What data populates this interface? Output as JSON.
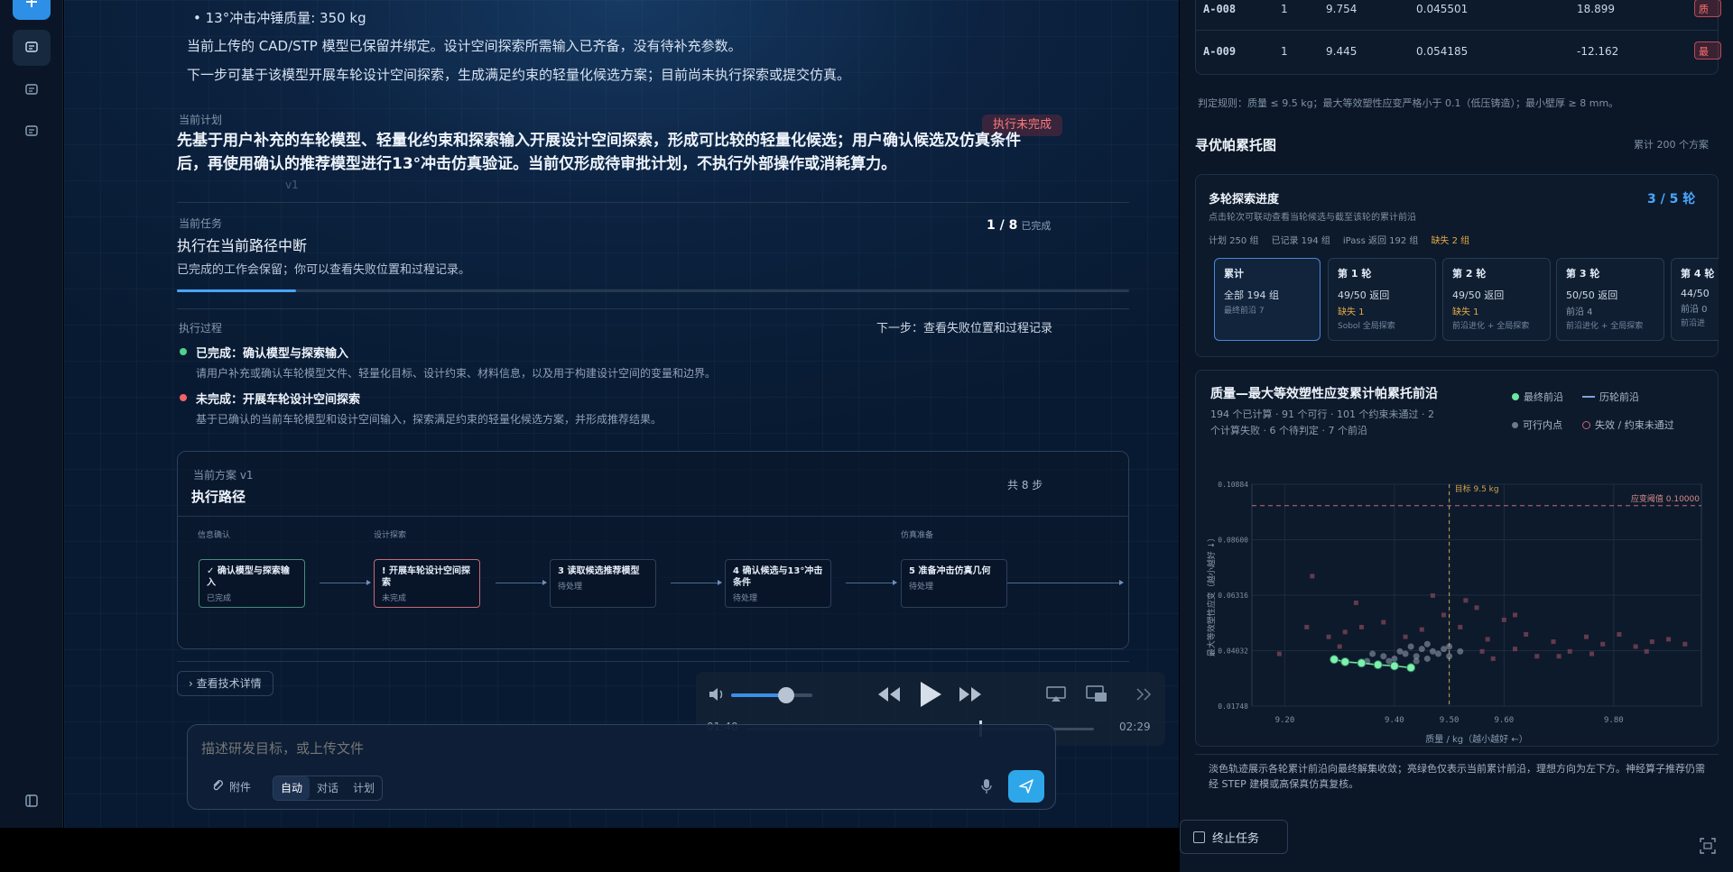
{
  "main": {
    "bullet": "13°冲击冲锤质量: 350 kg",
    "para1": "当前上传的 CAD/STP 模型已保留并绑定。设计空间探索所需输入已齐备，没有待补充参数。",
    "para2": "下一步可基于该模型开展车轮设计空间探索，生成满足约束的轻量化候选方案；目前尚未执行探索或提交仿真。",
    "plan_label": "当前计划",
    "plan_badge": "执行未完成",
    "plan_text": "先基于用户补充的车轮模型、轻量化约束和探索输入开展设计空间探索，形成可比较的轻量化候选；用户确认候选及仿真条件后，再使用确认的推荐模型进行13°冲击仿真验证。当前仅形成待审批计划，不执行外部操作或消耗算力。",
    "plan_version": "v1",
    "task_label": "当前任务",
    "task_title": "执行在当前路径中断",
    "task_desc": "已完成的工作会保留；你可以查看失败位置和过程记录。",
    "task_count": "1 / 8",
    "task_count_suffix": "已完成",
    "task_progress": 0.125,
    "process_label": "执行过程",
    "next_step": "下一步：查看失败位置和过程记录",
    "process_items": [
      {
        "title": "已完成：确认模型与探索输入",
        "desc": "请用户补充或确认车轮模型文件、轻量化目标、设计约束、材料信息，以及用于构建设计空间的变量和边界。",
        "color": "#4fd28a"
      },
      {
        "title": "未完成：开展车轮设计空间探索",
        "desc": "基于已确认的当前车轮模型和设计空间输入，探索满足约束的轻量化候选方案，并形成推荐结果。",
        "color": "#f06464"
      }
    ],
    "route": {
      "version_label": "当前方案  v1",
      "title": "执行路径",
      "total": "共 8 步",
      "groups": [
        "信息确认",
        "设计探索",
        "仿真准备"
      ],
      "steps": [
        {
          "mark": "✓",
          "title": "确认模型与探索输入",
          "status": "已完成"
        },
        {
          "mark": "!",
          "title": "开展车轮设计空间探索",
          "status": "未完成"
        },
        {
          "mark": "3",
          "title": "读取候选推荐模型",
          "status": "待处理"
        },
        {
          "mark": "4",
          "title": "确认候选与13°冲击条件",
          "status": "待处理"
        },
        {
          "mark": "5",
          "title": "准备冲击仿真几何",
          "status": "待处理"
        }
      ]
    },
    "tech_btn": "查看技术详情",
    "input": {
      "placeholder": "描述研发目标，或上传文件",
      "attach": "附件",
      "modes": [
        "自动",
        "对话",
        "计划"
      ]
    }
  },
  "media": {
    "time_current": "01:40",
    "time_total": "02:29",
    "volume": 0.68,
    "seek": 0.67
  },
  "right": {
    "table_rows": [
      {
        "id": "A-008",
        "n": "1",
        "mass": "9.754",
        "strain": "0.045501",
        "wall": "18.899",
        "tag": "质量"
      },
      {
        "id": "A-009",
        "n": "1",
        "mass": "9.445",
        "strain": "0.054185",
        "wall": "-12.162",
        "tag": "最小"
      }
    ],
    "rule": "判定规则：质量 ≤ 9.5 kg；最大等效塑性应变严格小于 0.1（低压铸造）；最小壁厚 ≥ 8 mm。",
    "section_title": "寻优帕累托图",
    "section_count": "累计 200 个方案",
    "progress": {
      "title": "多轮探索进度",
      "sub": "点击轮次可联动查看当轮候选与截至该轮的累计前沿",
      "ratio": "3 / 5 轮",
      "stats": [
        "计划 250 组",
        "已记录 194 组",
        "iPass 返回 192 组"
      ],
      "missing": "缺失 2 组",
      "rounds": [
        {
          "t": "累计",
          "a": "全部 194 组",
          "b": "",
          "c": "最终前沿 7"
        },
        {
          "t": "第 1 轮",
          "a": "49/50 返回",
          "b": "缺失 1",
          "c": "Sobol 全局探索"
        },
        {
          "t": "第 2 轮",
          "a": "49/50 返回",
          "b": "缺失 1",
          "c": "前沿进化 + 全局探索"
        },
        {
          "t": "第 3 轮",
          "a": "50/50 返回",
          "b": "前沿 4",
          "c": "前沿进化 + 全局探索"
        },
        {
          "t": "第 4 轮",
          "a": "44/50",
          "b": "前沿 0",
          "c": "前沿进"
        }
      ]
    },
    "chart_title": "质量—最大等效塑性应变累计帕累托前沿",
    "chart_sub1": "194 个已计算 · 91 个可行 · 101 个约束未通过 · 2",
    "chart_sub2": "个计算失败 · 6 个待判定 · 7 个前沿",
    "legend": [
      "最终前沿",
      "历轮前沿",
      "可行内点",
      "失效 / 约束未通过"
    ],
    "explain": "淡色轨迹展示各轮累计前沿向最终解集收敛；亮绿色仅表示当前累计前沿，理想方向为左下方。神经算子推荐仍需经 STEP 建模或高保真仿真复核。",
    "stop": "终止任务"
  },
  "chart_data": {
    "type": "scatter",
    "title": "质量—最大等效塑性应变累计帕累托前沿",
    "xlabel": "质量 / kg（越小越好 ←）",
    "ylabel": "最大等效塑性应变（越小越好 ↓）",
    "xlim": [
      9.14,
      9.96
    ],
    "ylim": [
      0.01748,
      0.10884
    ],
    "x_ticks": [
      "9.20",
      "9.40",
      "9.50",
      "9.60",
      "9.80"
    ],
    "x_tick_values": [
      9.2,
      9.4,
      9.5,
      9.6,
      9.8
    ],
    "y_ticks": [
      "0.01748",
      "0.04032",
      "0.06316",
      "0.08600",
      "0.10884"
    ],
    "y_tick_values": [
      0.01748,
      0.04032,
      0.06316,
      0.086,
      0.10884
    ],
    "target_label": "目标 9.5 kg",
    "target_x": 9.5,
    "threshold_label": "应变阈值 0.10000",
    "threshold_y": 0.1,
    "final_front": [
      [
        9.29,
        0.0367
      ],
      [
        9.31,
        0.0357
      ],
      [
        9.34,
        0.0352
      ],
      [
        9.37,
        0.0345
      ],
      [
        9.4,
        0.034
      ],
      [
        9.43,
        0.0333
      ]
    ],
    "feasible": [
      [
        9.35,
        0.036
      ],
      [
        9.38,
        0.038
      ],
      [
        9.4,
        0.037
      ],
      [
        9.42,
        0.039
      ],
      [
        9.44,
        0.038
      ],
      [
        9.45,
        0.041
      ],
      [
        9.46,
        0.037
      ],
      [
        9.47,
        0.04
      ],
      [
        9.48,
        0.039
      ],
      [
        9.49,
        0.041
      ],
      [
        9.5,
        0.038
      ],
      [
        9.43,
        0.042
      ],
      [
        9.41,
        0.04
      ],
      [
        9.39,
        0.036
      ],
      [
        9.36,
        0.039
      ],
      [
        9.44,
        0.036
      ],
      [
        9.46,
        0.043
      ],
      [
        9.5,
        0.042
      ],
      [
        9.52,
        0.04
      ],
      [
        9.37,
        0.035
      ]
    ],
    "failed": [
      [
        9.19,
        0.039
      ],
      [
        9.24,
        0.05
      ],
      [
        9.25,
        0.071
      ],
      [
        9.28,
        0.046
      ],
      [
        9.31,
        0.048
      ],
      [
        9.34,
        0.05
      ],
      [
        9.38,
        0.052
      ],
      [
        9.42,
        0.046
      ],
      [
        9.45,
        0.049
      ],
      [
        9.49,
        0.055
      ],
      [
        9.52,
        0.05
      ],
      [
        9.55,
        0.058
      ],
      [
        9.57,
        0.045
      ],
      [
        9.6,
        0.053
      ],
      [
        9.62,
        0.041
      ],
      [
        9.64,
        0.047
      ],
      [
        9.66,
        0.038
      ],
      [
        9.69,
        0.044
      ],
      [
        9.72,
        0.04
      ],
      [
        9.75,
        0.046
      ],
      [
        9.78,
        0.043
      ],
      [
        9.81,
        0.047
      ],
      [
        9.84,
        0.042
      ],
      [
        9.87,
        0.044
      ],
      [
        9.9,
        0.045
      ],
      [
        9.93,
        0.043
      ],
      [
        9.56,
        0.04
      ],
      [
        9.58,
        0.037
      ],
      [
        9.53,
        0.061
      ],
      [
        9.62,
        0.055
      ],
      [
        9.33,
        0.06
      ],
      [
        9.47,
        0.063
      ],
      [
        9.7,
        0.038
      ],
      [
        9.86,
        0.04
      ],
      [
        9.76,
        0.039
      ],
      [
        9.3,
        0.042
      ]
    ]
  }
}
